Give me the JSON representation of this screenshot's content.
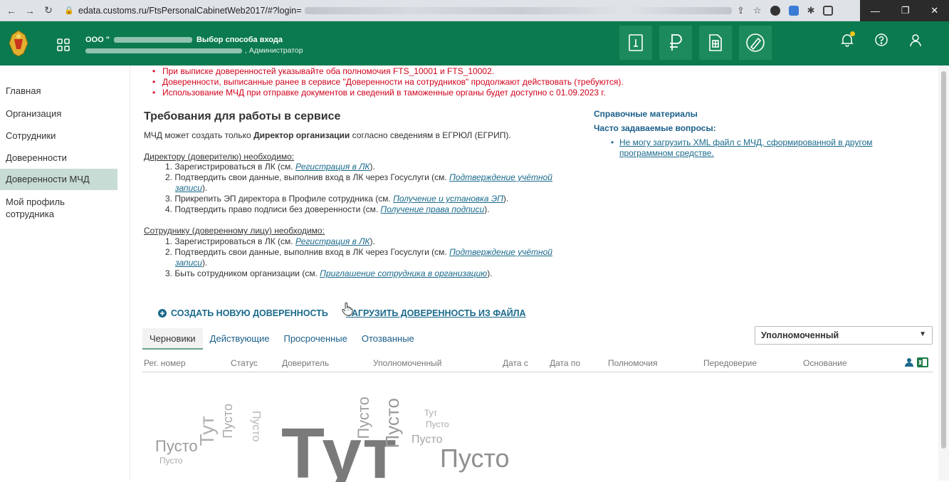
{
  "browser": {
    "url_visible": "edata.customs.ru/FtsPersonalCabinetWeb2017/#?login="
  },
  "header": {
    "org_prefix": "ООО \"",
    "login_mode": "Выбор способа входа",
    "user_suffix": ", Администратор"
  },
  "sidebar": {
    "items": [
      {
        "label": "Главная",
        "active": false
      },
      {
        "label": "Организация",
        "active": false
      },
      {
        "label": "Сотрудники",
        "active": false
      },
      {
        "label": "Доверенности",
        "active": false
      },
      {
        "label": "Доверенности МЧД",
        "active": true
      },
      {
        "label": "Мой профиль сотрудника",
        "active": false
      }
    ]
  },
  "notices": [
    "При выписке доверенностей указывайте оба полномочия FTS_10001 и FTS_10002.",
    "Доверенности, выписанные ранее в сервисе \"Доверенности на сотрудников\" продолжают действовать (требуются).",
    "Использование МЧД при отправке документов и сведений в таможенные органы будет доступно с 01.09.2023 г."
  ],
  "requirements": {
    "title": "Требования для работы в сервисе",
    "intro_prefix": "МЧД может создать только ",
    "intro_bold": "Директор организации",
    "intro_suffix": " согласно сведениям в ЕГРЮЛ (ЕГРИП).",
    "director_heading": "Директору (доверителю) необходимо",
    "director_steps": {
      "s1_text": "1. Зарегистрироваться в ЛК (см. ",
      "s1_link": "Регистрация в ЛК",
      "s1_end": ").",
      "s2_text": "2. Подтвердить свои данные, выполнив вход в ЛК через Госуслуги (см. ",
      "s2_link_a": "Подтверждение учётной",
      "s2_link_b": "записи",
      "s2_end": ").",
      "s3_text": "3. Прикрепить ЭП директора в Профиле сотрудника (см. ",
      "s3_link": "Получение и установка ЭП",
      "s3_end": ").",
      "s4_text": "4. Подтвердить право подписи без доверенности (см. ",
      "s4_link": "Получение права подписи",
      "s4_end": ")."
    },
    "employee_heading": "Сотруднику (доверенному лицу) необходимо",
    "employee_steps": {
      "s1_text": "1. Зарегистрироваться в ЛК (см. ",
      "s1_link": "Регистрация в ЛК",
      "s1_end": ").",
      "s2_text": "2. Подтвердить свои данные, выполнив вход в ЛК через Госуслуги (см. ",
      "s2_link_a": "Подтверждение учётной",
      "s2_link_b": "записи",
      "s2_end": ").",
      "s3_text": "3. Быть сотрудником организации (см. ",
      "s3_link": "Приглашение сотрудника в организацию",
      "s3_end": ")."
    }
  },
  "reference": {
    "title": "Справочные материалы",
    "faq_title": "Часто задаваемые вопросы:",
    "faq_item_a": "Не могу загрузить XML файл с МЧД, сформированной в другом",
    "faq_item_b": "программном средстве."
  },
  "actions": {
    "create": "Создать новую доверенность",
    "upload": "Загрузить доверенность из файла"
  },
  "tabs": [
    "Черновики",
    "Действующие",
    "Просроченные",
    "Отозванные"
  ],
  "filter_select": "Уполномоченный",
  "table_headers": [
    "Рег. номер",
    "Статус",
    "Доверитель",
    "Уполномоченный",
    "Дата с",
    "Дата по",
    "Полномочия",
    "Передоверие",
    "Основание"
  ],
  "empty_words": {
    "big": "Тут",
    "large": "Пусто",
    "medium": "Пусто",
    "small_a": "Тут",
    "small_b": "Пусто",
    "tiny_a": "Пусто",
    "tiny_b": "Тут",
    "tiny_c": "Пусто"
  },
  "colors": {
    "header_green": "#0b7a4f",
    "notice_red": "#d0021b",
    "link_blue": "#1a6a8c",
    "active_sidebar": "#c7dcd5"
  }
}
